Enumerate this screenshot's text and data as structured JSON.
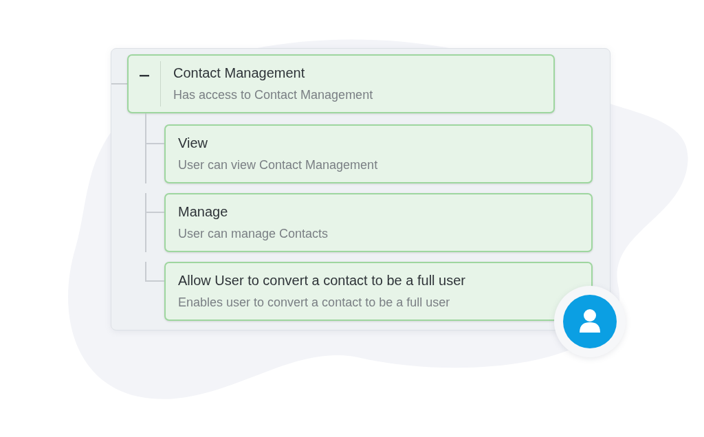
{
  "permission_tree": {
    "title": "Contact Management",
    "description": "Has access to Contact Management",
    "expanded": true,
    "children": [
      {
        "title": "View",
        "description": "User can view Contact Management"
      },
      {
        "title": "Manage",
        "description": "User can manage Contacts"
      },
      {
        "title": "Allow User to convert a contact to be a full user",
        "description": "Enables user to convert a contact to be a full user"
      }
    ]
  }
}
